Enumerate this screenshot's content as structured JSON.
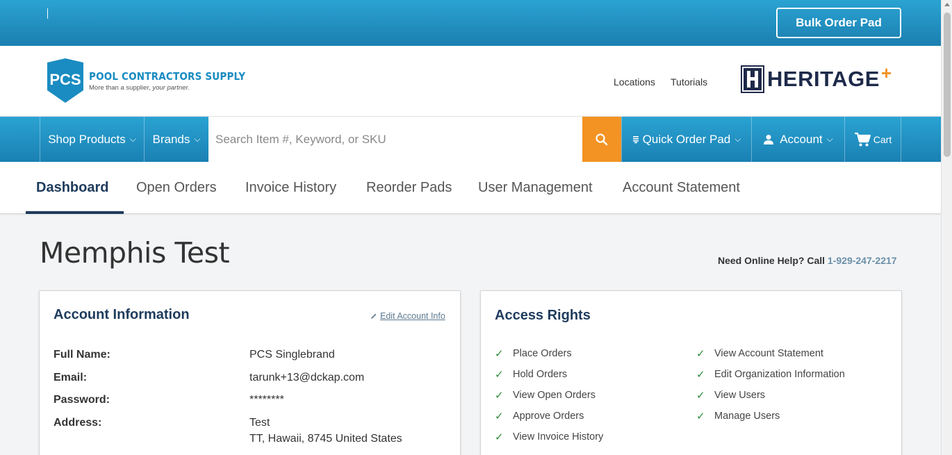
{
  "topbar": {
    "bulk_order_label": "Bulk Order Pad"
  },
  "logo": {
    "abbr": "PCS",
    "name": "POOL CONTRACTORS SUPPLY",
    "tagline_prefix": "More than a supplier, ",
    "tagline_italic": "your partner.",
    "partner_logo": "HERITAGE",
    "partner_plus": "+"
  },
  "top_links": {
    "locations": "Locations",
    "tutorials": "Tutorials"
  },
  "nav": {
    "shop_products": "Shop Products",
    "brands": "Brands",
    "search_placeholder": "Search Item #, Keyword, or SKU",
    "quick_order_pad": "Quick Order Pad",
    "account": "Account",
    "cart": "Cart"
  },
  "tabs": [
    {
      "label": "Dashboard",
      "active": true
    },
    {
      "label": "Open Orders"
    },
    {
      "label": "Invoice History"
    },
    {
      "label": "Reorder Pads"
    },
    {
      "label": "User Management"
    },
    {
      "label": "Account Statement"
    }
  ],
  "page": {
    "title": "Memphis Test",
    "help_text": "Need Online Help? Call ",
    "help_phone": "1-929-247-2217"
  },
  "account_info": {
    "title": "Account Information",
    "edit_label": "Edit Account Info",
    "full_name_label": "Full Name:",
    "full_name": "PCS Singlebrand",
    "email_label": "Email:",
    "email": "tarunk+13@dckap.com",
    "password_label": "Password:",
    "password": "********",
    "address_label": "Address:",
    "address_line1": "Test",
    "address_line2": "TT, Hawaii, 8745 United States"
  },
  "access_rights": {
    "title": "Access Rights",
    "check_glyph": "✓",
    "left": [
      "Place Orders",
      "Hold Orders",
      "View Open Orders",
      "Approve Orders",
      "View Invoice History"
    ],
    "right": [
      "View Account Statement",
      "Edit Organization Information",
      "View Users",
      "Manage Users"
    ]
  },
  "colors": {
    "brand_blue": "#1e8fc4",
    "accent_orange": "#f39323",
    "navy": "#1e3b5c",
    "check_green": "#2e8b3a"
  }
}
